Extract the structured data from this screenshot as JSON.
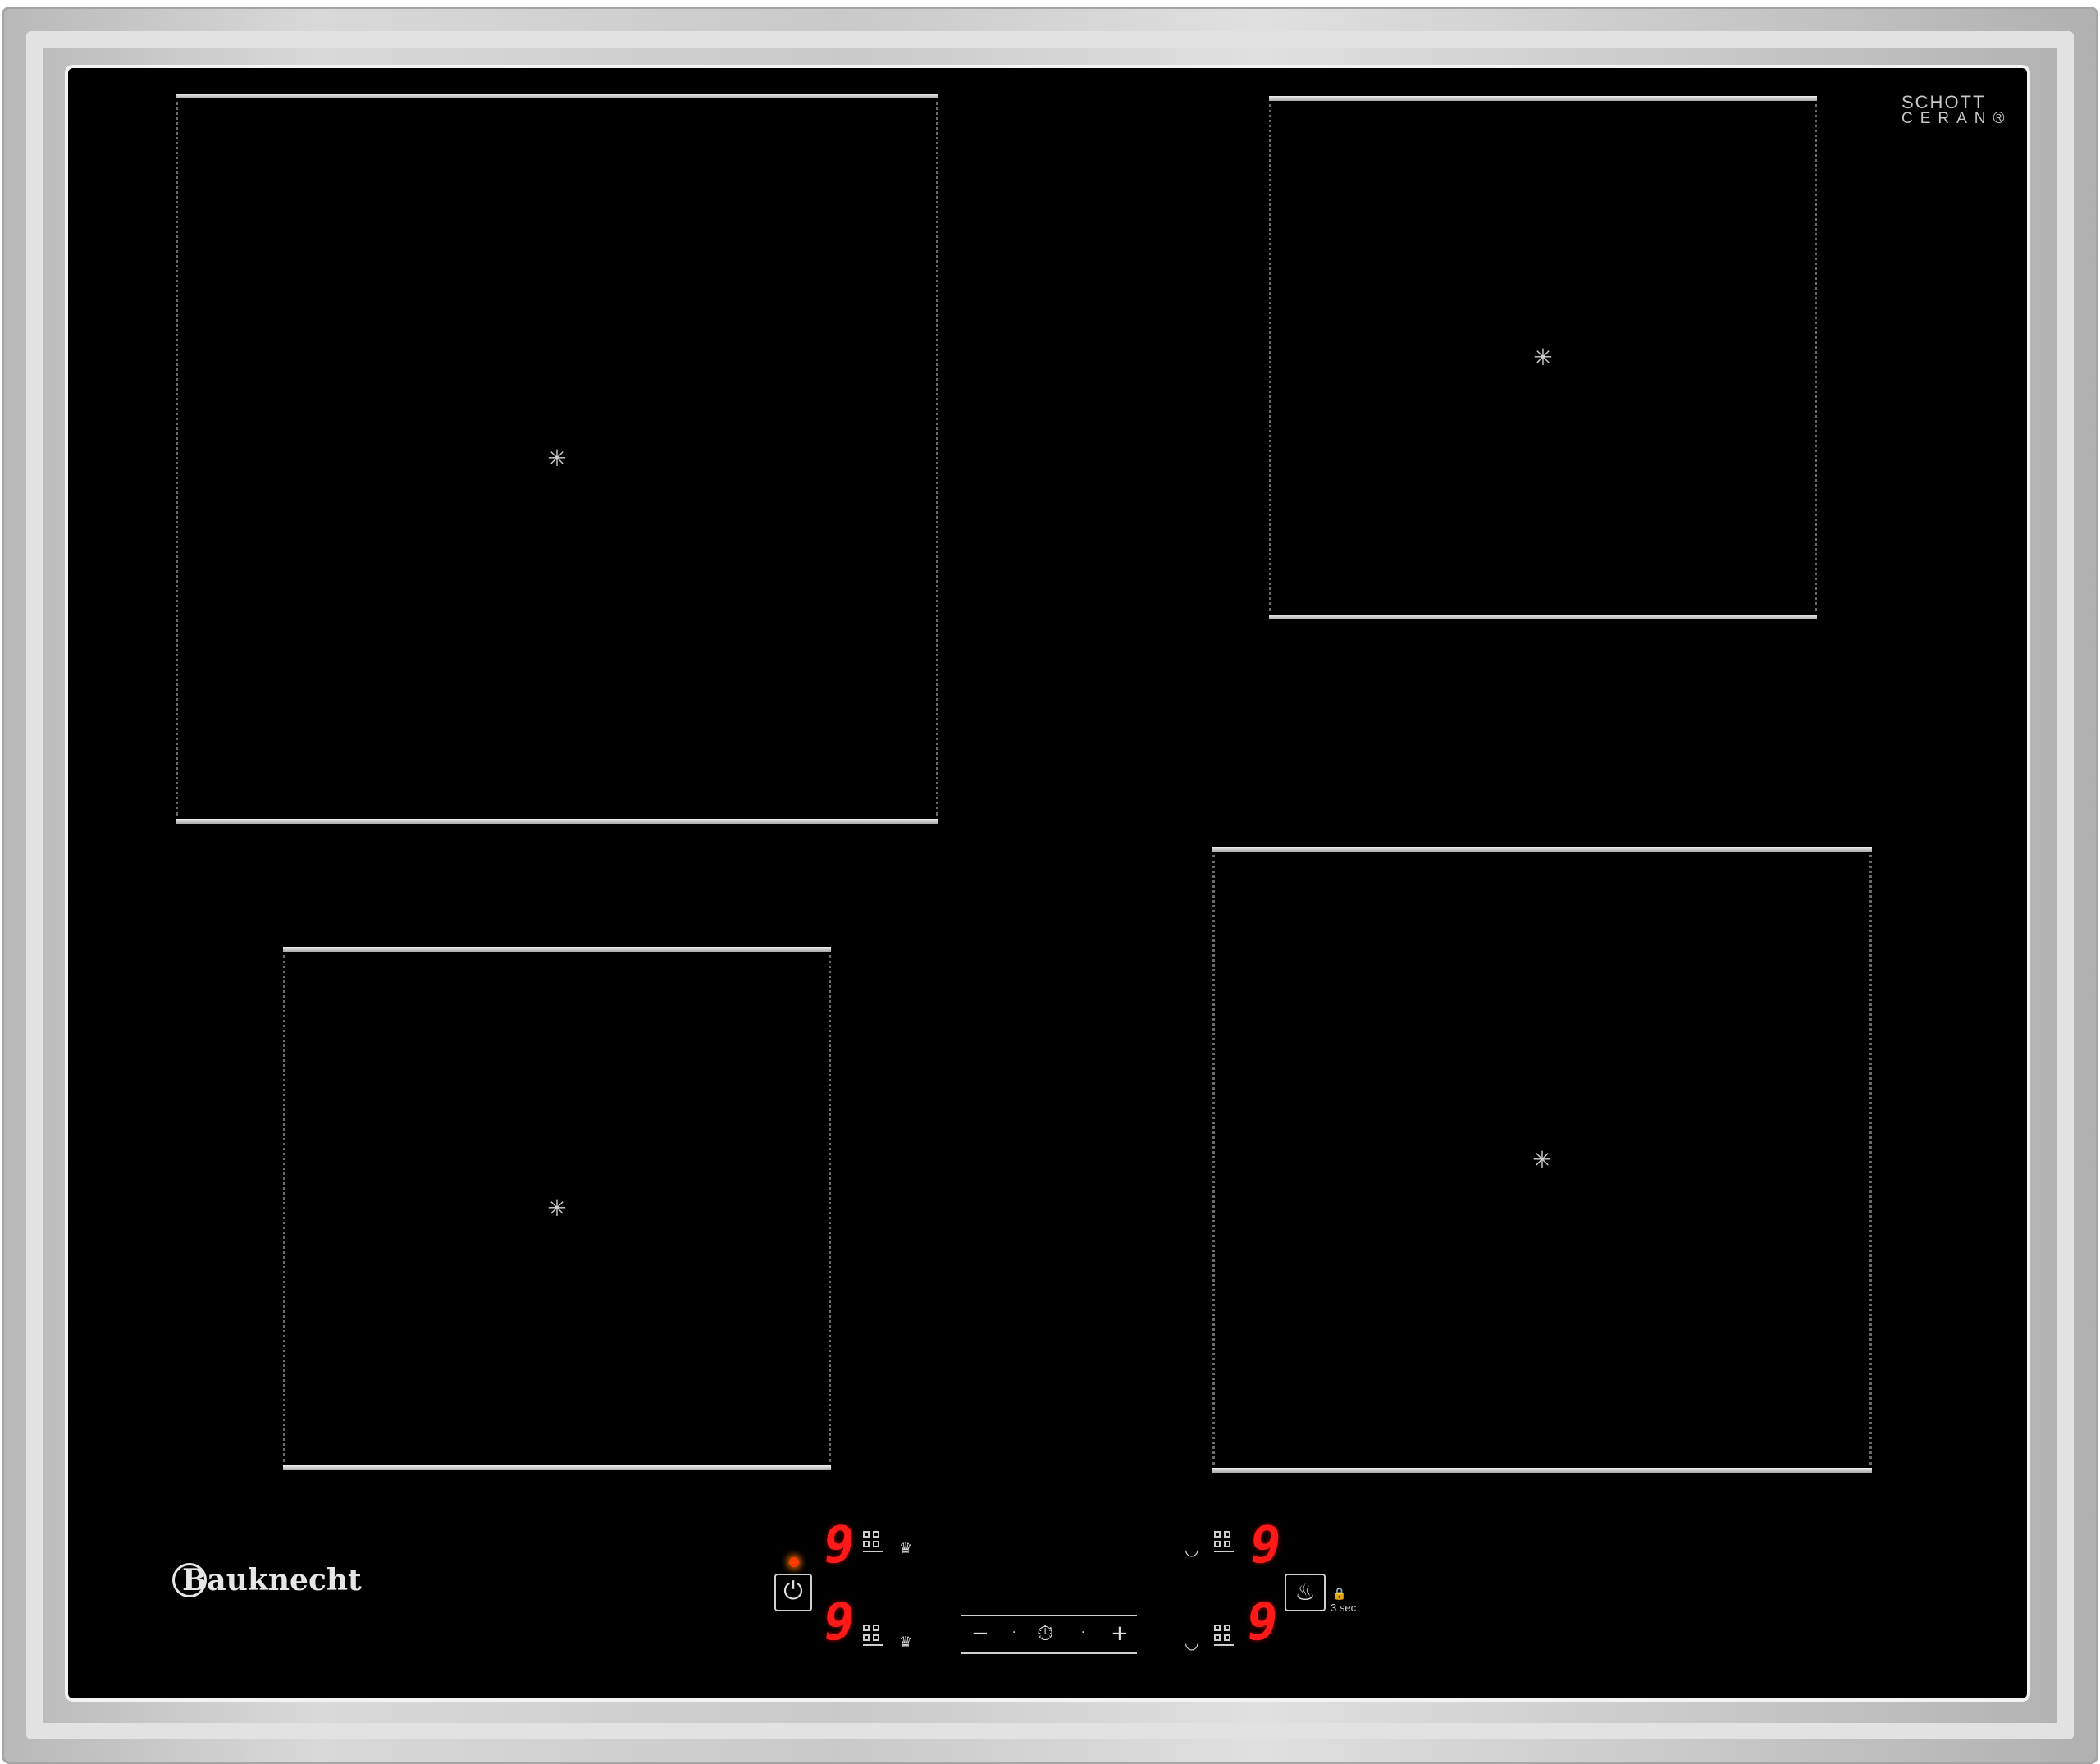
{
  "cooktop": {
    "material_brand_line1": "SCHOTT",
    "material_brand_line2": "CERAN®",
    "manufacturer": "Bauknecht",
    "colors": {
      "glass": "#000000",
      "frame": "#c8c8c8",
      "display": "#ff1a1a",
      "power_led": "#ff3a00"
    }
  },
  "zones": [
    {
      "name": "rear-left",
      "center_icon": "✳"
    },
    {
      "name": "rear-right",
      "center_icon": "✳"
    },
    {
      "name": "front-left",
      "center_icon": "✳"
    },
    {
      "name": "front-right",
      "center_icon": "✳"
    }
  ],
  "controls": {
    "rear_left_level": "9",
    "front_left_level": "9",
    "rear_right_level": "9",
    "front_right_level": "9",
    "power_symbol": "⏻",
    "timer_minus": "−",
    "timer_plus": "+",
    "timer_symbol": "⏱",
    "chef_symbol": "♨",
    "lock_symbol": "🔒",
    "lock_duration": "3 sec",
    "pan_icon": "♛",
    "pot_icon": "◡"
  }
}
